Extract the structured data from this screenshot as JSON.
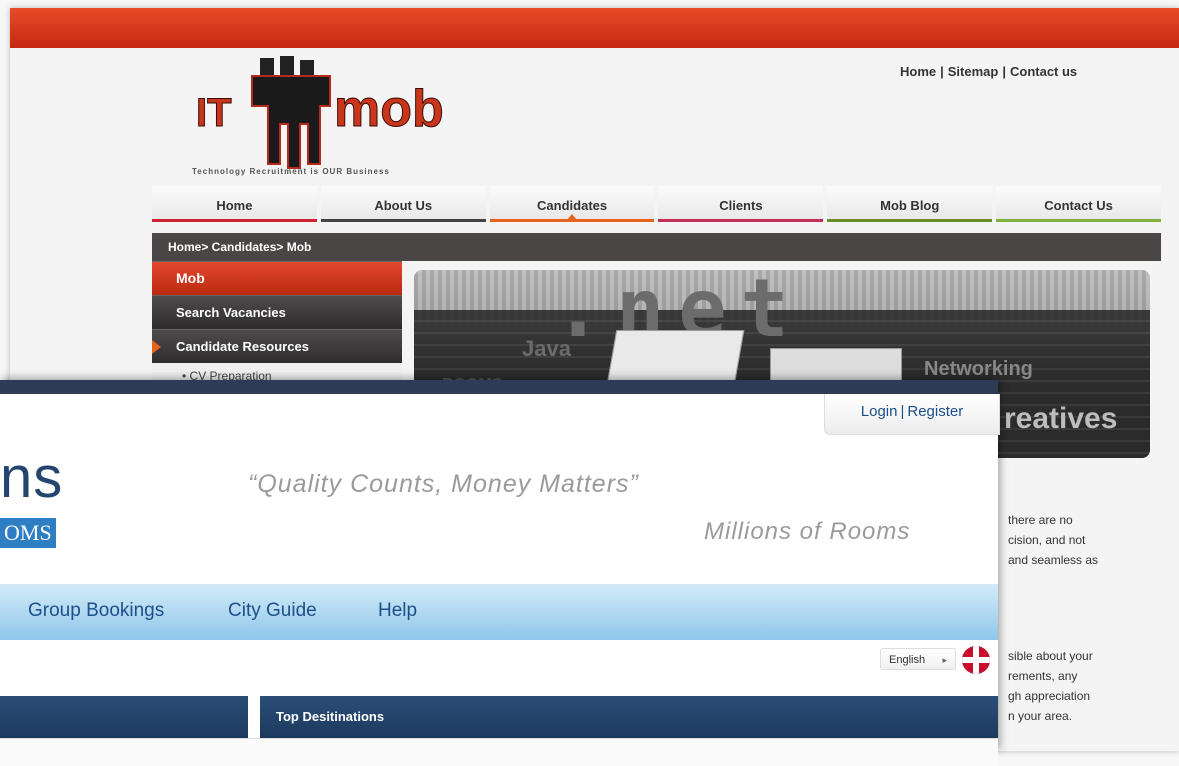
{
  "back_site": {
    "top_links": [
      "Home",
      "Sitemap",
      "Contact us"
    ],
    "top_links_separator": "|",
    "logo": {
      "left": "IT",
      "right": "mob",
      "tagline": "Technology Recruitment is OUR Business"
    },
    "nav_tabs": [
      "Home",
      "About Us",
      "Candidates",
      "Clients",
      "Mob Blog",
      "Contact Us"
    ],
    "active_tab": "Candidates",
    "breadcrumb": "Home> Candidates> Mob",
    "side_menu": {
      "items": [
        "Mob",
        "Search Vacancies",
        "Candidate Resources"
      ],
      "active": "Mob",
      "sub_items": [
        "• CV Preparation"
      ]
    },
    "banner_words": [
      ".net",
      "Java",
      "ROOMS",
      "Networking",
      "reatives"
    ],
    "body_lines": [
      "there are no",
      "cision, and not",
      "and seamless as",
      "sible about your",
      "rements, any",
      "gh appreciation",
      "n your area."
    ]
  },
  "front_site": {
    "login_label": "Login",
    "register_label": "Register",
    "login_separator": "|",
    "logo_text": "ns",
    "logo_badge": "OMS",
    "tagline": "“Quality Counts, Money Matters”",
    "subtagline": "Millions of Rooms",
    "nav_items": [
      "Group Bookings",
      "City Guide",
      "Help"
    ],
    "language": "English",
    "language_arrow": "▸",
    "panel_right_title": "Top Desitinations"
  },
  "colors": {
    "back_topbar": "#d23a1c",
    "back_active_red": "#e4482c",
    "front_header_bar": "#2f3b54",
    "front_nav_blue": "#8fc7ea",
    "front_text_blue": "#1d4f8a",
    "panel_blue": "#1c3a5e"
  }
}
